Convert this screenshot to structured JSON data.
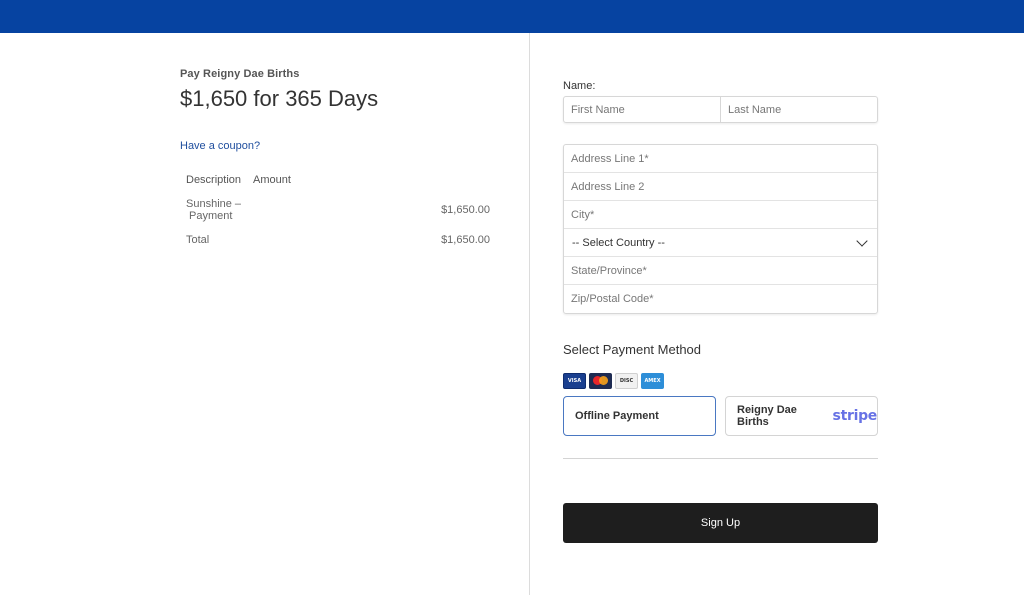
{
  "colors": {
    "topbar": "#0643a1",
    "link": "#1f4e9e",
    "signup_bg": "#1e1e1e",
    "stripe_brand": "#6772e5"
  },
  "summary": {
    "pay_label": "Pay Reigny Dae Births",
    "price_title": "$1,650 for 365 Days",
    "coupon_link": "Have a coupon?",
    "headers": {
      "description": "Description",
      "amount": "Amount"
    },
    "rows": [
      {
        "description": "Sunshine – Payment",
        "amount": "$1,650.00"
      }
    ],
    "total": {
      "label": "Total",
      "amount": "$1,650.00"
    }
  },
  "form": {
    "name_label": "Name:",
    "first_name_placeholder": "First Name",
    "last_name_placeholder": "Last Name",
    "address1_placeholder": "Address Line 1*",
    "address2_placeholder": "Address Line 2",
    "city_placeholder": "City*",
    "country_selected": "-- Select Country --",
    "state_placeholder": "State/Province*",
    "zip_placeholder": "Zip/Postal Code*"
  },
  "payment": {
    "title": "Select Payment Method",
    "cards": [
      "VISA",
      "mastercard",
      "DISCOVER",
      "AMEX"
    ],
    "offline_label": "Offline Payment",
    "stripe_label": "Reigny Dae Births",
    "stripe_logo": "stripe"
  },
  "signup_label": "Sign Up"
}
